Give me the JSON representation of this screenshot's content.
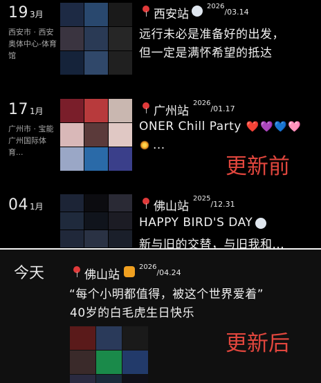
{
  "entries": [
    {
      "day": "19",
      "month": "3月",
      "location": "西安市 · 西安奥体中心-体育馆",
      "station": "西安站",
      "year": "2026",
      "monthday": "/03.14",
      "lines": [
        "远行未必是准备好的出发，",
        "但一定是满怀希望的抵达"
      ],
      "tiles": [
        "#1d2a44",
        "#29486e",
        "#1a1a1a",
        "#3a3440",
        "#2a3a55",
        "#262626",
        "#15233a",
        "#30486a",
        "#202020"
      ]
    },
    {
      "day": "17",
      "month": "1月",
      "location": "广州市 · 宝能广州国际体育...",
      "station": "广州站",
      "year": "2026",
      "monthday": "/01.17",
      "lines": [
        "ONER Chill Party",
        "..."
      ],
      "tiles": [
        "#7a1e2a",
        "#b83a3c",
        "#c9b7b0",
        "#d9b8b8",
        "#5b3a3a",
        "#e0c8c4",
        "#9aa7c6",
        "#2a6aa8",
        "#3a3f8a"
      ]
    },
    {
      "day": "04",
      "month": "1月",
      "station": "佛山站",
      "year": "2025",
      "monthday": "/12.31",
      "lines": [
        "HAPPY BIRD'S DAY",
        "新与旧的交替，与旧我和..."
      ],
      "tiles": [
        "#1c2436",
        "#0c0c10",
        "#2a2a35",
        "#1f2a3c",
        "#10141c",
        "#1c1c24",
        "#20283a",
        "#2a3244",
        "#1a1f2a"
      ]
    }
  ],
  "hearts": [
    "❤️",
    "💜",
    "💙",
    "🩷"
  ],
  "annotation_before": "更新前",
  "annotation_after": "更新后",
  "today": {
    "label": "今天",
    "station": "佛山站",
    "year": "2026",
    "monthday": "/04.24",
    "lines": [
      "“每个小明都值得，被这个世界爱着”",
      "40岁的白毛虎生日快乐"
    ],
    "tiles": [
      "#5a1a1a",
      "#2a3a5a",
      "#1a1a1a",
      "#3a2a2a",
      "#1a8a4a",
      "#223a6a",
      "#2a2a40",
      "#1a2a3a",
      "#101018"
    ]
  }
}
